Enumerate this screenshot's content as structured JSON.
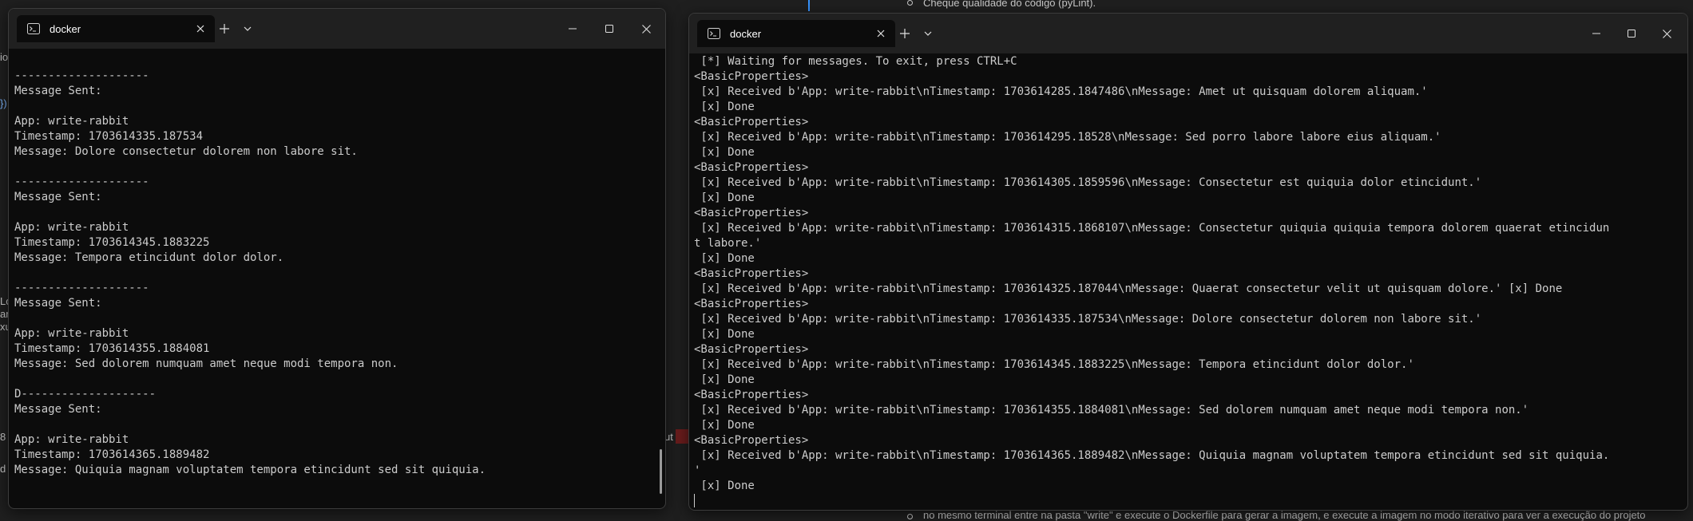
{
  "background": {
    "top_bullet_text": "Cheque qualidade do código (pyLint).",
    "bottom_text": "no mesmo terminal entre na pasta \"write\" e execute o Dockerfile para gerar a imagem, e execute a imagem no modo iterativo para ver a execução do projeto",
    "fragments": [
      "io",
      "})",
      "Lo",
      "ar",
      "xu",
      "8",
      "d",
      "ut"
    ]
  },
  "colors": {
    "terminal_bg": "#0c0c0c",
    "titlebar_bg": "#202020",
    "terminal_text": "#cccccc"
  },
  "left_window": {
    "tab_title": "docker",
    "icons": {
      "tab": "terminal-icon",
      "close_tab": "close-icon",
      "new_tab": "plus-icon",
      "dropdown": "chevron-down-icon",
      "minimize": "minimize-icon",
      "maximize": "maximize-icon",
      "close": "close-icon"
    },
    "lines": [
      "",
      "--------------------",
      "Message Sent:",
      "",
      "App: write-rabbit",
      "Timestamp: 1703614335.187534",
      "Message: Dolore consectetur dolorem non labore sit.",
      "",
      "--------------------",
      "Message Sent:",
      "",
      "App: write-rabbit",
      "Timestamp: 1703614345.1883225",
      "Message: Tempora etincidunt dolor dolor.",
      "",
      "--------------------",
      "Message Sent:",
      "",
      "App: write-rabbit",
      "Timestamp: 1703614355.1884081",
      "Message: Sed dolorem numquam amet neque modi tempora non.",
      "",
      "D--------------------",
      "Message Sent:",
      "",
      "App: write-rabbit",
      "Timestamp: 1703614365.1889482",
      "Message: Quiquia magnam voluptatem tempora etincidunt sed sit quiquia."
    ]
  },
  "right_window": {
    "tab_title": "docker",
    "lines": [
      " [*] Waiting for messages. To exit, press CTRL+C",
      "<BasicProperties>",
      " [x] Received b'App: write-rabbit\\nTimestamp: 1703614285.1847486\\nMessage: Amet ut quisquam dolorem aliquam.'",
      " [x] Done",
      "<BasicProperties>",
      " [x] Received b'App: write-rabbit\\nTimestamp: 1703614295.18528\\nMessage: Sed porro labore labore eius aliquam.'",
      " [x] Done",
      "<BasicProperties>",
      " [x] Received b'App: write-rabbit\\nTimestamp: 1703614305.1859596\\nMessage: Consectetur est quiquia dolor etincidunt.'",
      " [x] Done",
      "<BasicProperties>",
      " [x] Received b'App: write-rabbit\\nTimestamp: 1703614315.1868107\\nMessage: Consectetur quiquia quiquia tempora dolorem quaerat etincidun",
      "t labore.'",
      " [x] Done",
      "<BasicProperties>",
      " [x] Received b'App: write-rabbit\\nTimestamp: 1703614325.187044\\nMessage: Quaerat consectetur velit ut quisquam dolore.' [x] Done",
      "<BasicProperties>",
      " [x] Received b'App: write-rabbit\\nTimestamp: 1703614335.187534\\nMessage: Dolore consectetur dolorem non labore sit.'",
      " [x] Done",
      "<BasicProperties>",
      " [x] Received b'App: write-rabbit\\nTimestamp: 1703614345.1883225\\nMessage: Tempora etincidunt dolor dolor.'",
      " [x] Done",
      "<BasicProperties>",
      " [x] Received b'App: write-rabbit\\nTimestamp: 1703614355.1884081\\nMessage: Sed dolorem numquam amet neque modi tempora non.'",
      " [x] Done",
      "<BasicProperties>",
      " [x] Received b'App: write-rabbit\\nTimestamp: 1703614365.1889482\\nMessage: Quiquia magnam voluptatem tempora etincidunt sed sit quiquia.",
      "'",
      " [x] Done"
    ]
  }
}
